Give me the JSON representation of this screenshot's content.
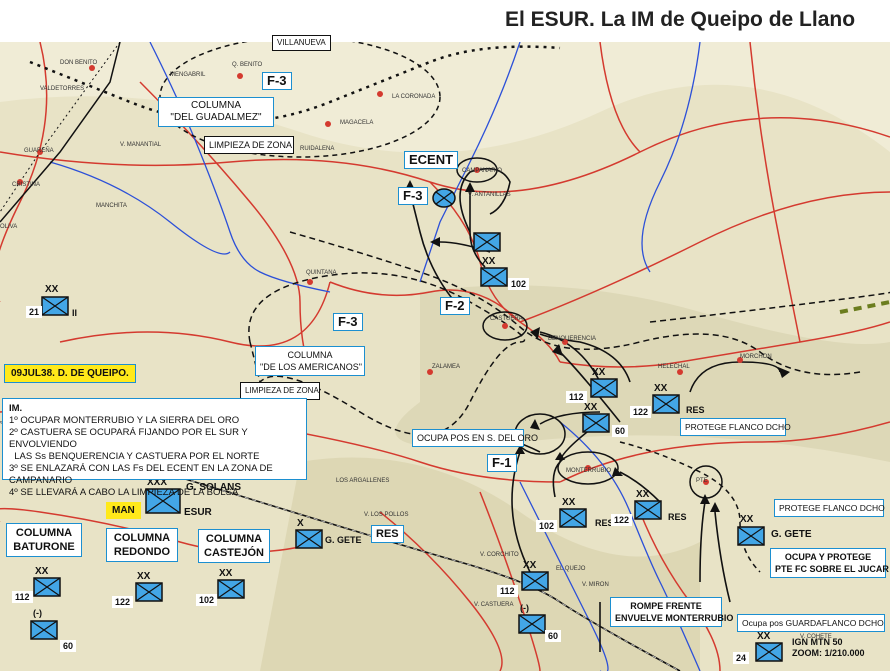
{
  "title": "El ESUR. La IM de Queipo de Llano",
  "colors": {
    "friendly_fill": "#43a6e6",
    "friendly_stroke": "#1a1a1a",
    "label_border": "#1c8fd0",
    "highlight": "#ffe91a",
    "road_red": "#d43a2f",
    "river_blue": "#2c50d8"
  },
  "labels": {
    "villanueva": "VILLANUEVA",
    "f3_top": "F-3",
    "col_guadalmez": [
      "COLUMNA",
      "\"DEL GUADALMEZ\""
    ],
    "limpieza_top": "LIMPIEZA DE ZONA",
    "ecent": "ECENT",
    "f3_mid": "F-3",
    "f2": "F-2",
    "f3_left": "F-3",
    "col_americanos": [
      "COLUMNA",
      "\"DE LOS AMERICANOS\""
    ],
    "fecha": "09JUL38. D. DE QUEIPO.",
    "limpieza_mid": "LIMPIEZA DE ZONA",
    "ocupa_pos": "OCUPA POS EN S. DEL ORO",
    "f1": "F-1",
    "protege_1": "PROTEGE FLANCO DCHO",
    "protege_2": "PROTEGE FLANCO DCHO",
    "g_solans": "G. SOLANS",
    "man": "MAN",
    "esur": "ESUR",
    "col_baturone": [
      "COLUMNA",
      "BATURONE"
    ],
    "col_redondo": [
      "COLUMNA",
      "REDONDO"
    ],
    "col_castejon": [
      "COLUMNA",
      "CASTEJÓN"
    ],
    "g_gete_1": "G. GETE",
    "res_box": "RES",
    "g_gete_2": "G. GETE",
    "ocupa_protege": [
      "OCUPA Y PROTEGE",
      "PTE FC SOBRE EL JUCAR"
    ],
    "rompe_frente": [
      "ROMPE FRENTE",
      "ENVUELVE MONTERRUBIO"
    ],
    "ocupa_guardaflanco": "Ocupa pos GUARDAFLANCO DCHO",
    "ign": [
      "IGN MTN 50",
      "ZOOM: 1/210.000"
    ]
  },
  "im_box": [
    "IM.",
    "1º OCUPAR MONTERRUBIO Y LA SIERRA DEL ORO",
    "2º CASTUERA SE OCUPARÁ  FIJANDO POR EL SUR  Y ENVOLVIENDO",
    "  LAS Ss BENQUERENCIA Y CASTUERA POR EL NORTE",
    "3º SE ENLAZARÁ CON LAS Fs DEL ECENT EN LA ZONA DE CAMPANARIO",
    "4º SE LLEVARÁ A CABO LA LIMPIEZA DE LA BOLSA"
  ],
  "units": [
    {
      "id": "u21",
      "num": "21",
      "side": "II",
      "echelon": "XX"
    },
    {
      "id": "u102a",
      "num": "102",
      "echelon": "XX"
    },
    {
      "id": "u112a",
      "num": "112",
      "echelon": "XX"
    },
    {
      "id": "u60a",
      "num": "60",
      "echelon": "XX"
    },
    {
      "id": "u122a",
      "num": "122",
      "side": "RES",
      "echelon": "XX"
    },
    {
      "id": "u102b",
      "num": "102",
      "side": "RES",
      "echelon": "XX"
    },
    {
      "id": "u122b",
      "num": "122",
      "side": "RES",
      "echelon": "XX"
    },
    {
      "id": "u112b",
      "num": "112",
      "echelon": "XX"
    },
    {
      "id": "u60b",
      "num": "60",
      "echelon": "(-)"
    },
    {
      "id": "ubat112",
      "num": "112",
      "echelon": "XX"
    },
    {
      "id": "ubat60",
      "num": "60",
      "echelon": "(-)"
    },
    {
      "id": "ured122",
      "num": "122",
      "echelon": "XX"
    },
    {
      "id": "ucas102",
      "num": "102",
      "echelon": "XX"
    },
    {
      "id": "u24",
      "num": "24",
      "echelon": "XX"
    }
  ],
  "place_names": [
    "Q. BENITO",
    "VALDETORRES",
    "MENGABRIL",
    "DON BENITO",
    "LA CORONADA",
    "MAGACELA",
    "RUIDALENA",
    "V. MANANTIAL",
    "CRISTINA",
    "GUAREÑA",
    "MANCHITA",
    "OLIVA",
    "CAMPANARIO",
    "V. ANTANILLAS",
    "QUINTANA",
    "CASTUERA",
    "BENQUERENCIA",
    "HELECHAL",
    "MORCHON",
    "ZALAMEA",
    "MONTERRUBIO",
    "LOS ARGALLENES",
    "V. LOS POLLOS",
    "V. CORCHITO",
    "V. CASTUERA",
    "EL QUEJO",
    "V. MIRON",
    "V. COHETE",
    "PTE"
  ]
}
